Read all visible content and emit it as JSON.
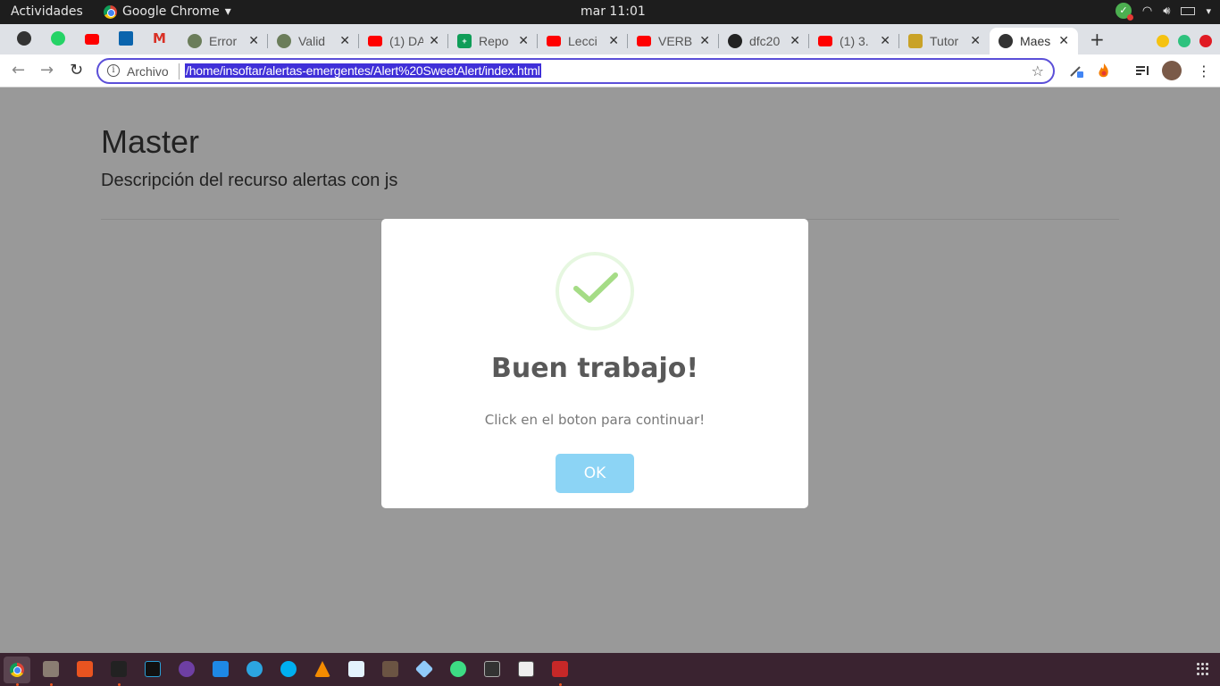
{
  "topbar": {
    "activities": "Actividades",
    "app_name": "Google Chrome",
    "clock": "mar 11:01"
  },
  "tabs": [
    {
      "title": "Error",
      "icon": "settings-icon"
    },
    {
      "title": "Valid",
      "icon": "settings-icon"
    },
    {
      "title": "(1) DA",
      "icon": "youtube-icon"
    },
    {
      "title": "Repo",
      "icon": "sheets-icon"
    },
    {
      "title": "Lecci",
      "icon": "youtube-icon"
    },
    {
      "title": "VERB",
      "icon": "youtube-icon"
    },
    {
      "title": "dfc20",
      "icon": "github-icon"
    },
    {
      "title": "(1) 3.",
      "icon": "youtube-icon"
    },
    {
      "title": "Tutor",
      "icon": "tutorial-icon"
    },
    {
      "title": "Maes",
      "icon": "globe-icon"
    }
  ],
  "omnibox": {
    "scheme_label": "Archivo",
    "url": "/home/insoftar/alertas-emergentes/Alert%20SweetAlert/index.html"
  },
  "page": {
    "title": "Master",
    "description": "Descripción del recurso alertas con js"
  },
  "modal": {
    "title": "Buen trabajo!",
    "text": "Click en el boton para continuar!",
    "ok_label": "OK",
    "success_color": "#a5dc86",
    "button_color": "#8cd4f5"
  },
  "colors": {
    "overlay": "#999999",
    "taskbar": "#3a2330",
    "omnibox_border": "#5b4fd8",
    "selection": "#4030d8"
  }
}
